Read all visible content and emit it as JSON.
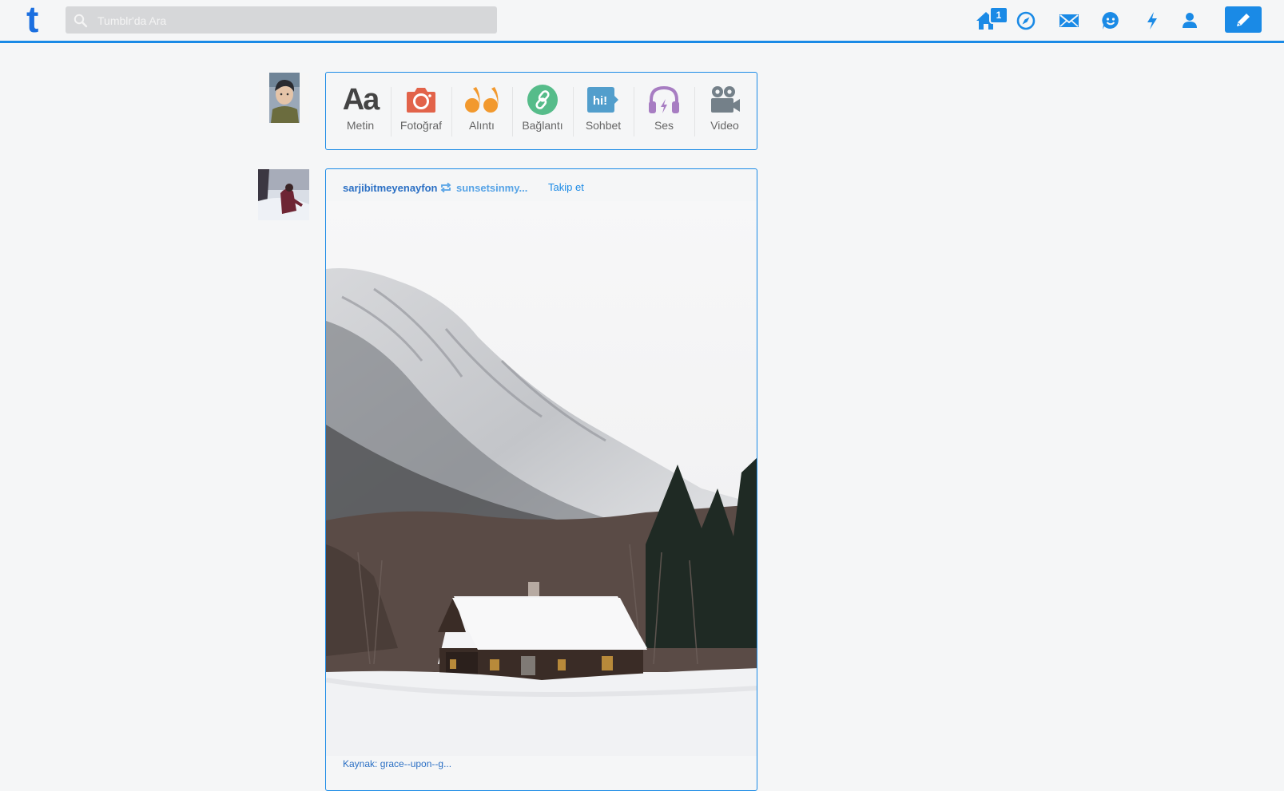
{
  "header": {
    "logo": "t",
    "search": {
      "placeholder": "Tumblr'da Ara",
      "value": ""
    },
    "nav": {
      "home_badge": "1",
      "icons": [
        "home-icon",
        "compass-icon",
        "mail-icon",
        "smiley-icon",
        "lightning-icon",
        "person-icon",
        "pencil-icon"
      ]
    },
    "colors": {
      "accent": "#1a8ae6",
      "background": "#f5f6f7"
    }
  },
  "composer": {
    "types": [
      {
        "label": "Metin",
        "icon": "text-icon",
        "color": "#444444"
      },
      {
        "label": "Fotoğraf",
        "icon": "camera-icon",
        "color": "#e2634a"
      },
      {
        "label": "Alıntı",
        "icon": "quote-icon",
        "color": "#f2992e"
      },
      {
        "label": "Bağlantı",
        "icon": "link-icon",
        "color": "#56bc8a"
      },
      {
        "label": "Sohbet",
        "icon": "chat-icon",
        "color": "#529ecc"
      },
      {
        "label": "Ses",
        "icon": "headphones-icon",
        "color": "#a77dc2"
      },
      {
        "label": "Video",
        "icon": "video-camera-icon",
        "color": "#748089"
      }
    ]
  },
  "post": {
    "blog_name": "sarjibitmeyenayfon",
    "reblogged_from": "sunsetsinmy...",
    "follow_label": "Takip et",
    "source": "Kaynak: grace--upon--g..."
  }
}
